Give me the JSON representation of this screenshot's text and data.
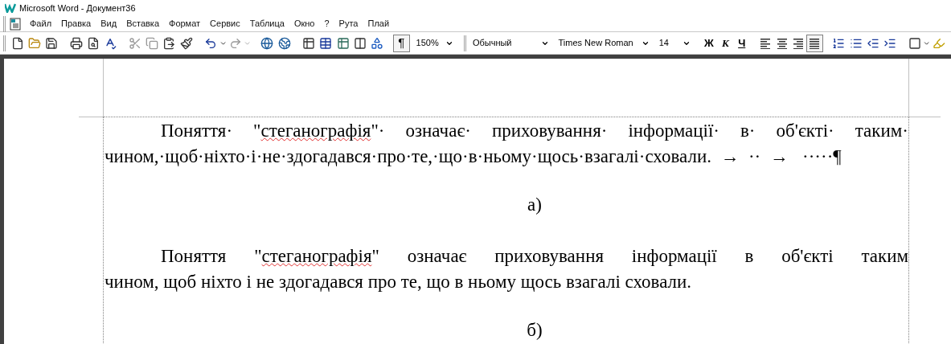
{
  "window": {
    "title": "Microsoft Word - Документ36"
  },
  "menu": [
    "Файл",
    "Правка",
    "Вид",
    "Вставка",
    "Формат",
    "Сервис",
    "Таблица",
    "Окно",
    "?",
    "Рута",
    "Плай"
  ],
  "toolbar": {
    "show_marks": {
      "label": "¶",
      "pressed": true
    },
    "zoom": "150%",
    "style": "Обычный",
    "font": "Times New Roman",
    "size": "14",
    "format_buttons": [
      {
        "label": "Ж",
        "kind": "bold"
      },
      {
        "label": "К",
        "kind": "italic"
      },
      {
        "label": "Ч",
        "kind": "underline"
      }
    ],
    "align_buttons": [
      {
        "kind": "left",
        "selected": false
      },
      {
        "kind": "center",
        "selected": false
      },
      {
        "kind": "right",
        "selected": false
      },
      {
        "kind": "justify",
        "selected": true
      }
    ]
  },
  "document": [
    {
      "kind": "paragraph",
      "lines": [
        [
          {
            "text": "Поняття· \""
          },
          {
            "text": "стеганографія",
            "misspelled": true
          },
          {
            "text": "\"· означає· приховування· інформації· в· об'єкті· таким·"
          }
        ],
        [
          {
            "text": "чином,·щоб·ніхто·і·не·здогадався·про·те,·що·в·ньому·щось·взагалі·сховали.  →  ··  →   ·····¶"
          }
        ]
      ]
    },
    {
      "kind": "caption",
      "text": "а)"
    },
    {
      "kind": "paragraph",
      "lines": [
        [
          {
            "text": "Поняття \""
          },
          {
            "text": "стеганографія",
            "misspelled": true
          },
          {
            "text": "\" означає приховування інформації в об'єкті таким"
          }
        ],
        [
          {
            "text": "чином, щоб ніхто і не здогадався про те, що в ньому щось взагалі сховали."
          }
        ]
      ]
    },
    {
      "kind": "caption",
      "text": "б)"
    }
  ]
}
